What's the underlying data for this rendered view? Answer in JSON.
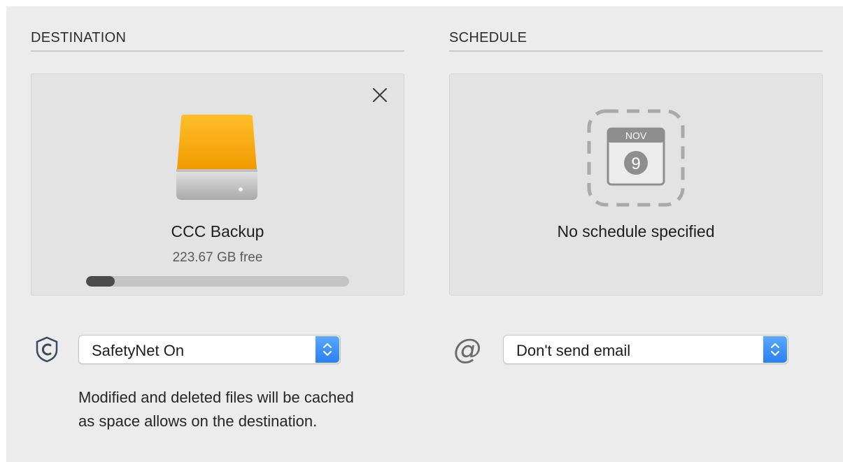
{
  "destination": {
    "section_title": "DESTINATION",
    "volume_name": "CCC Backup",
    "free_space": "223.67 GB free",
    "used_fraction": 0.11,
    "drive_color": "#f5a800",
    "close_icon": "close-icon",
    "safetynet": {
      "icon": "shield-c-icon",
      "selected": "SafetyNet On",
      "description": "Modified and deleted files will be cached as space allows on the destination."
    }
  },
  "schedule": {
    "section_title": "SCHEDULE",
    "calendar_month": "NOV",
    "calendar_day": "9",
    "status": "No schedule specified",
    "email": {
      "icon": "at-icon",
      "selected": "Don't send email"
    }
  },
  "colors": {
    "popup_accent": "#2a7ff3",
    "panel_bg": "#e3e3e3"
  }
}
